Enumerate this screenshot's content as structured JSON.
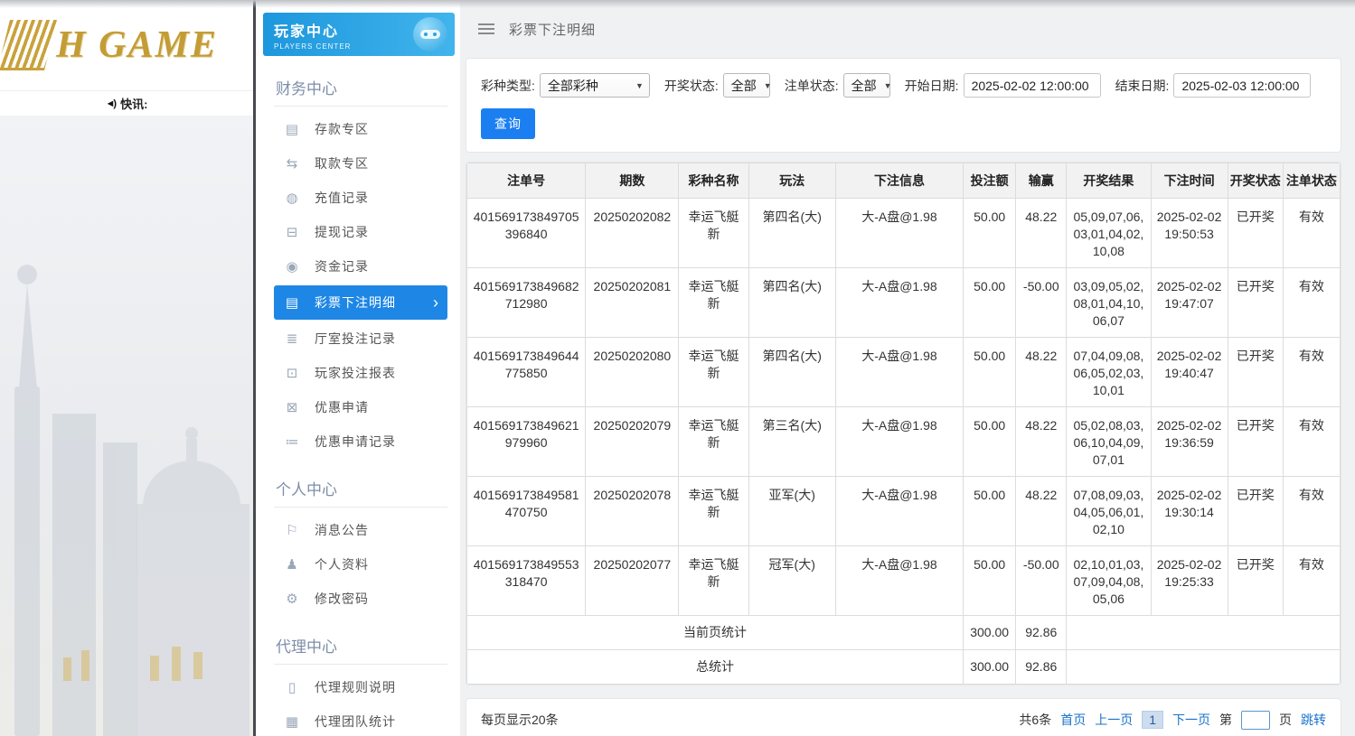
{
  "colors": {
    "accent_blue": "#1e87e5",
    "link_blue": "#1a73c9",
    "brand_gold": "#c9a23c"
  },
  "brand": {
    "logo_text": "H GAME",
    "news_label": "快讯:"
  },
  "sidebar": {
    "title": "玩家中心",
    "subtitle": "PLAYERS CENTER",
    "sections": [
      {
        "label": "财务中心",
        "items": [
          {
            "key": "deposit-zone",
            "label": "存款专区",
            "glyph": "▤",
            "active": false
          },
          {
            "key": "withdraw-zone",
            "label": "取款专区",
            "glyph": "⇆",
            "active": false
          },
          {
            "key": "recharge-record",
            "label": "充值记录",
            "glyph": "◍",
            "active": false
          },
          {
            "key": "withdraw-record",
            "label": "提现记录",
            "glyph": "⊟",
            "active": false
          },
          {
            "key": "funds-record",
            "label": "资金记录",
            "glyph": "◉",
            "active": false
          },
          {
            "key": "lottery-bet-detail",
            "label": "彩票下注明细",
            "glyph": "▤",
            "active": true
          },
          {
            "key": "hall-bet-record",
            "label": "厅室投注记录",
            "glyph": "≣",
            "active": false
          },
          {
            "key": "player-bet-report",
            "label": "玩家投注报表",
            "glyph": "⊡",
            "active": false
          },
          {
            "key": "promo-apply",
            "label": "优惠申请",
            "glyph": "⊠",
            "active": false
          },
          {
            "key": "promo-apply-record",
            "label": "优惠申请记录",
            "glyph": "≔",
            "active": false
          }
        ]
      },
      {
        "label": "个人中心",
        "items": [
          {
            "key": "message-notice",
            "label": "消息公告",
            "glyph": "⚐",
            "active": false
          },
          {
            "key": "profile",
            "label": "个人资料",
            "glyph": "♟",
            "active": false
          },
          {
            "key": "change-password",
            "label": "修改密码",
            "glyph": "⚙",
            "active": false
          }
        ]
      },
      {
        "label": "代理中心",
        "items": [
          {
            "key": "agent-rules",
            "label": "代理规则说明",
            "glyph": "▯",
            "active": false
          },
          {
            "key": "agent-team-stats",
            "label": "代理团队统计",
            "glyph": "▦",
            "active": false
          }
        ]
      }
    ]
  },
  "header": {
    "title": "彩票下注明细"
  },
  "filters": {
    "lottery_type_label": "彩种类型:",
    "lottery_type_value": "全部彩种",
    "draw_status_label": "开奖状态:",
    "draw_status_value": "全部",
    "bet_status_label": "注单状态:",
    "bet_status_value": "全部",
    "start_date_label": "开始日期:",
    "start_date_value": "2025-02-02 12:00:00",
    "end_date_label": "结束日期:",
    "end_date_value": "2025-02-03 12:00:00",
    "query_button": "查询"
  },
  "table": {
    "columns": [
      {
        "key": "bet-no",
        "label": "注单号"
      },
      {
        "key": "period",
        "label": "期数"
      },
      {
        "key": "lottery-name",
        "label": "彩种名称"
      },
      {
        "key": "play-method",
        "label": "玩法"
      },
      {
        "key": "bet-info",
        "label": "下注信息"
      },
      {
        "key": "bet-amount",
        "label": "投注额"
      },
      {
        "key": "win-loss",
        "label": "输赢"
      },
      {
        "key": "draw-result",
        "label": "开奖结果"
      },
      {
        "key": "bet-time",
        "label": "下注时间"
      },
      {
        "key": "draw-status",
        "label": "开奖状态"
      },
      {
        "key": "bet-status",
        "label": "注单状态"
      }
    ],
    "rows": [
      [
        "401569173849705396840",
        "20250202082",
        "幸运飞艇新",
        "第四名(大)",
        "大-A盘@1.98",
        "50.00",
        "48.22",
        "05,09,07,06,03,01,04,02,10,08",
        "2025-02-02 19:50:53",
        "已开奖",
        "有效"
      ],
      [
        "401569173849682712980",
        "20250202081",
        "幸运飞艇新",
        "第四名(大)",
        "大-A盘@1.98",
        "50.00",
        "-50.00",
        "03,09,05,02,08,01,04,10,06,07",
        "2025-02-02 19:47:07",
        "已开奖",
        "有效"
      ],
      [
        "401569173849644775850",
        "20250202080",
        "幸运飞艇新",
        "第四名(大)",
        "大-A盘@1.98",
        "50.00",
        "48.22",
        "07,04,09,08,06,05,02,03,10,01",
        "2025-02-02 19:40:47",
        "已开奖",
        "有效"
      ],
      [
        "401569173849621979960",
        "20250202079",
        "幸运飞艇新",
        "第三名(大)",
        "大-A盘@1.98",
        "50.00",
        "48.22",
        "05,02,08,03,06,10,04,09,07,01",
        "2025-02-02 19:36:59",
        "已开奖",
        "有效"
      ],
      [
        "401569173849581470750",
        "20250202078",
        "幸运飞艇新",
        "亚军(大)",
        "大-A盘@1.98",
        "50.00",
        "48.22",
        "07,08,09,03,04,05,06,01,02,10",
        "2025-02-02 19:30:14",
        "已开奖",
        "有效"
      ],
      [
        "401569173849553318470",
        "20250202077",
        "幸运飞艇新",
        "冠军(大)",
        "大-A盘@1.98",
        "50.00",
        "-50.00",
        "02,10,01,03,07,09,04,08,05,06",
        "2025-02-02 19:25:33",
        "已开奖",
        "有效"
      ]
    ],
    "summary": [
      {
        "label": "当前页统计",
        "bet": "300.00",
        "win": "92.86"
      },
      {
        "label": "总统计",
        "bet": "300.00",
        "win": "92.86"
      }
    ]
  },
  "pagination": {
    "page_size_text": "每页显示20条",
    "total_text": "共6条",
    "first": "首页",
    "prev": "上一页",
    "current": "1",
    "next": "下一页",
    "jump_prefix": "第",
    "jump_suffix": "页",
    "jump_button": "跳转"
  }
}
